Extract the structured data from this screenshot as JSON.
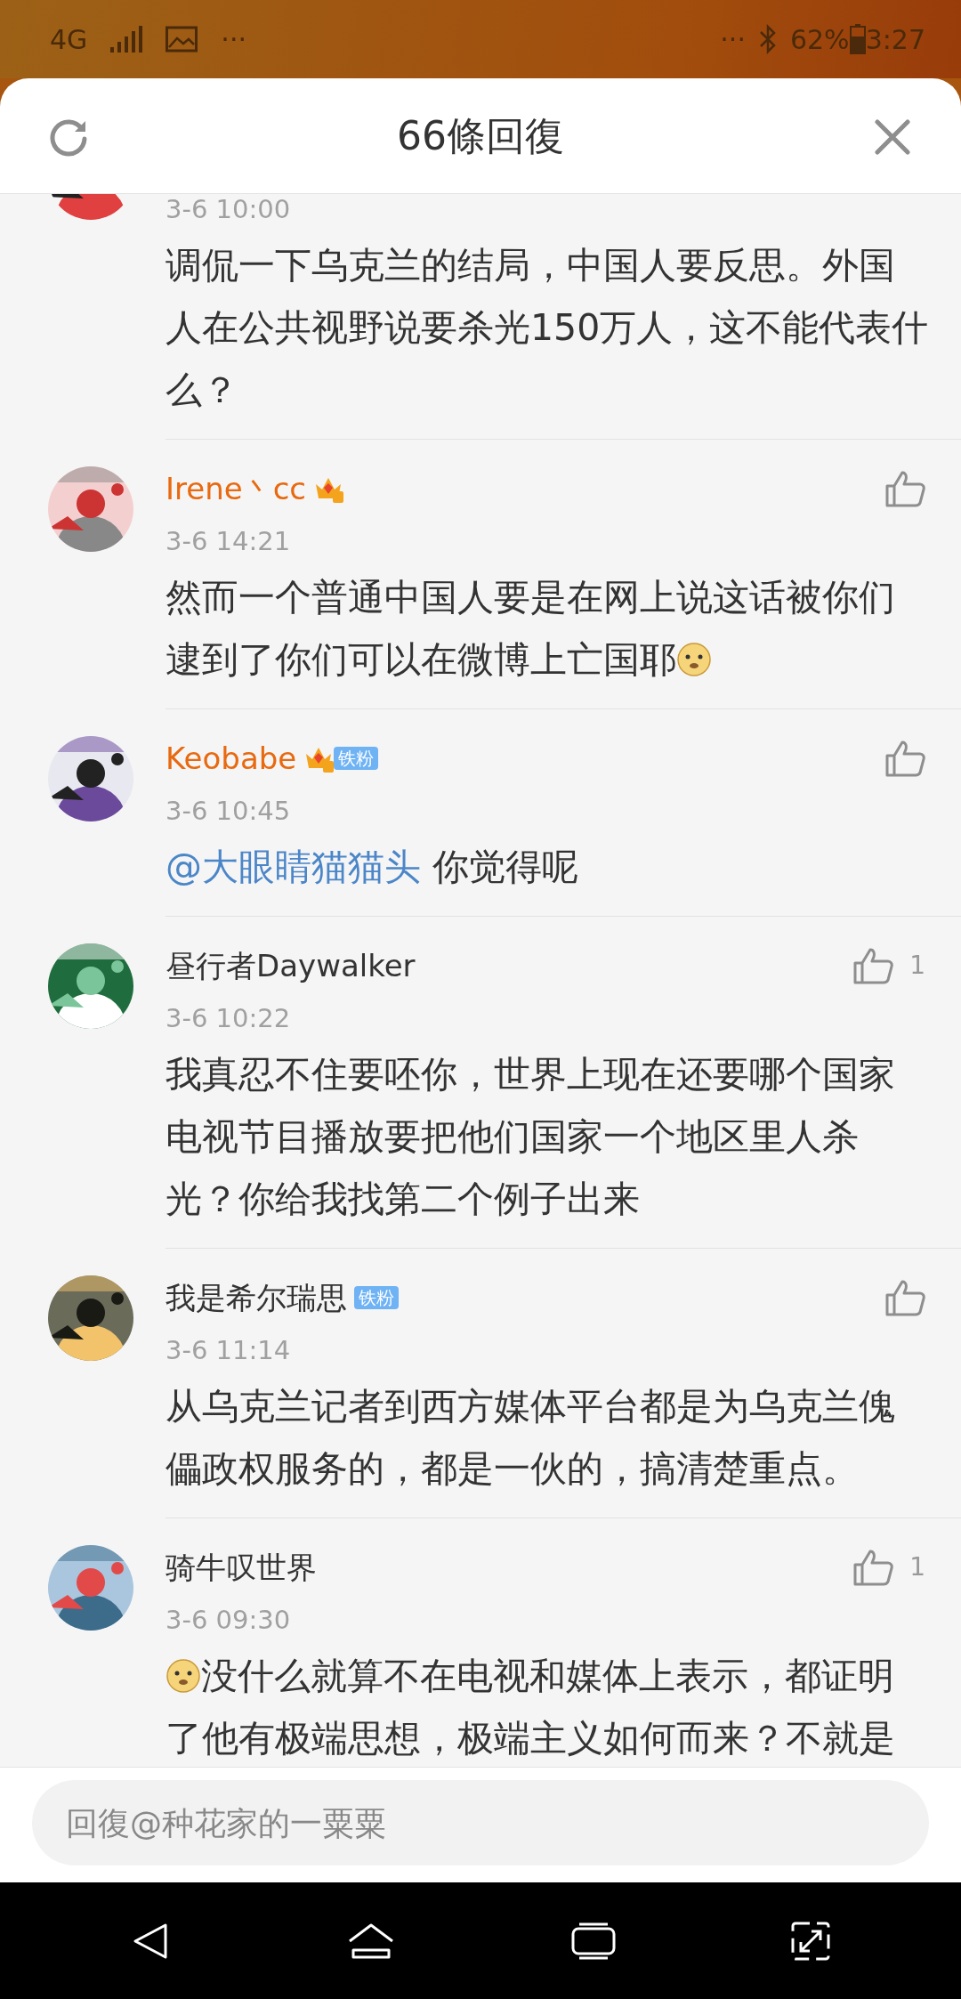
{
  "status_bar": {
    "network": "4G",
    "left_more": "···",
    "right_more": "···",
    "battery": "62%",
    "time": "3:27"
  },
  "header": {
    "title": "66條回復"
  },
  "comments": [
    {
      "time": "3-6 10:00",
      "text": "调侃一下乌克兰的结局，中国人要反思。外国人在公共视野说要杀光150万人，这不能代表什么？"
    },
    {
      "name": "Irene丶cc",
      "vip": true,
      "time": "3-6 14:21",
      "lines": [
        "然而一个普通中国人要是在网上说这话被你们",
        "逮到了你们可以在微博上亡国耶"
      ],
      "emoji_after": true
    },
    {
      "name": "Keobabe",
      "vip": true,
      "fan_badge": "铁粉",
      "time": "3-6 10:45",
      "mention": "@大眼睛猫猫头",
      "text": " 你觉得呢"
    },
    {
      "name": "昼行者Daywalker",
      "vip": false,
      "likes": "1",
      "time": "3-6 10:22",
      "text": "我真忍不住要呸你，世界上现在还要哪个国家电视节目播放要把他们国家一个地区里人杀光？你给我找第二个例子出来"
    },
    {
      "name": "我是希尔瑞思",
      "vip": false,
      "fan_badge": "铁粉",
      "time": "3-6 11:14",
      "text": "从乌克兰记者到西方媒体平台都是为乌克兰傀儡政权服务的，都是一伙的，搞清楚重点。"
    },
    {
      "name": "骑牛叹世界",
      "vip": false,
      "likes": "1",
      "time": "3-6 09:30",
      "lines": [
        "没什么就算不在电视和媒体上表示，都证明",
        "了他有极端思想，极端主义如何而来？不就是"
      ],
      "emoji_before": true
    }
  ],
  "reply": {
    "placeholder": "回復@种花家的一粟粟"
  }
}
